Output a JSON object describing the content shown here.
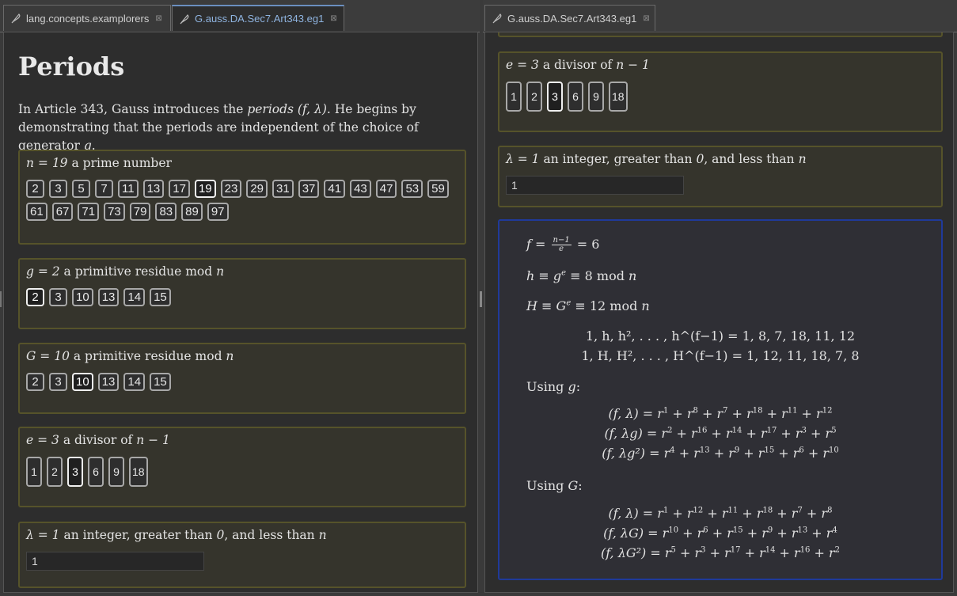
{
  "left": {
    "tabs": [
      {
        "label": "lang.concepts.examplorers",
        "active": false
      },
      {
        "label": "G.auss.DA.Sec7.Art343.eg1",
        "active": true
      }
    ],
    "title": "Periods",
    "intro_pre": "In Article 343, Gauss introduces the ",
    "intro_em": "periods",
    "intro_math": " (f, λ)",
    "intro_mid": ". He begins by demonstrating that the periods are independent of the choice of generator ",
    "intro_g": "g",
    "intro_end": ".",
    "n_box": {
      "label_math": "n = 19",
      "label_text": " a prime number",
      "options": [
        "2",
        "3",
        "5",
        "7",
        "11",
        "13",
        "17",
        "19",
        "23",
        "29",
        "31",
        "37",
        "41",
        "43",
        "47",
        "53",
        "59",
        "61",
        "67",
        "71",
        "73",
        "79",
        "83",
        "89",
        "97"
      ],
      "selected": "19"
    },
    "g_box": {
      "label_math": "g = 2",
      "label_text": " a primitive residue mod ",
      "label_n": "n",
      "options": [
        "2",
        "3",
        "10",
        "13",
        "14",
        "15"
      ],
      "selected": "2"
    },
    "G_box": {
      "label_math": "G = 10",
      "label_text": " a primitive residue mod ",
      "label_n": "n",
      "options": [
        "2",
        "3",
        "10",
        "13",
        "14",
        "15"
      ],
      "selected": "10"
    },
    "e_box": {
      "label_math": "e = 3",
      "label_text": " a divisor of ",
      "label_n": "n − 1",
      "options": [
        "1",
        "2",
        "3",
        "6",
        "9",
        "18"
      ],
      "selected": "3"
    },
    "lambda_box": {
      "label_math": "λ = 1",
      "label_text": " an integer, greater than ",
      "label_zero": "0",
      "label_text2": ", and less than ",
      "label_n": "n",
      "value": "1"
    }
  },
  "right": {
    "tabs": [
      {
        "label": "G.auss.DA.Sec7.Art343.eg1",
        "active": false
      }
    ],
    "e_box": {
      "label_math": "e = 3",
      "label_text": " a divisor of ",
      "label_n": "n − 1",
      "options": [
        "1",
        "2",
        "3",
        "6",
        "9",
        "18"
      ],
      "selected": "3"
    },
    "lambda_box": {
      "label_math": "λ = 1",
      "label_text": " an integer, greater than ",
      "label_zero": "0",
      "label_text2": ", and less than ",
      "label_n": "n",
      "value": "1"
    },
    "result": {
      "f_lhs": "f = ",
      "f_num": "n−1",
      "f_den": "e",
      "f_rhs": " = 6",
      "h_line_pre": "h ≡ g",
      "h_line_sup": "e",
      "h_line_post": " ≡ 8 ",
      "mod": "mod",
      "mod_n": " n",
      "H_line_pre": "H ≡ G",
      "H_line_sup": "e",
      "H_line_post": " ≡ 12 ",
      "h_powers": "1, h, h², . . . , h^(f−1) = 1, 8, 7, 18, 11, 12",
      "H_powers": "1, H, H², . . . , H^(f−1) = 1, 12, 11, 18, 7, 8",
      "using_g": "Using ",
      "using_g_var": "g",
      "using_G": "Using ",
      "using_G_var": "G",
      "colon": ":",
      "g_periods": [
        {
          "lhs": "(f, λ)",
          "exps": [
            "1",
            "8",
            "7",
            "18",
            "11",
            "12"
          ]
        },
        {
          "lhs": "(f, λg)",
          "exps": [
            "2",
            "16",
            "14",
            "17",
            "3",
            "5"
          ]
        },
        {
          "lhs": "(f, λg²)",
          "exps": [
            "4",
            "13",
            "9",
            "15",
            "6",
            "10"
          ]
        }
      ],
      "G_periods": [
        {
          "lhs": "(f, λ)",
          "exps": [
            "1",
            "12",
            "11",
            "18",
            "7",
            "8"
          ]
        },
        {
          "lhs": "(f, λG)",
          "exps": [
            "10",
            "6",
            "15",
            "9",
            "13",
            "4"
          ]
        },
        {
          "lhs": "(f, λG²)",
          "exps": [
            "5",
            "3",
            "17",
            "14",
            "16",
            "2"
          ]
        }
      ]
    }
  },
  "colors": {
    "box_border": "#56532a",
    "result_border": "#1f3a9a",
    "active_tab": "#8fb4e0"
  }
}
